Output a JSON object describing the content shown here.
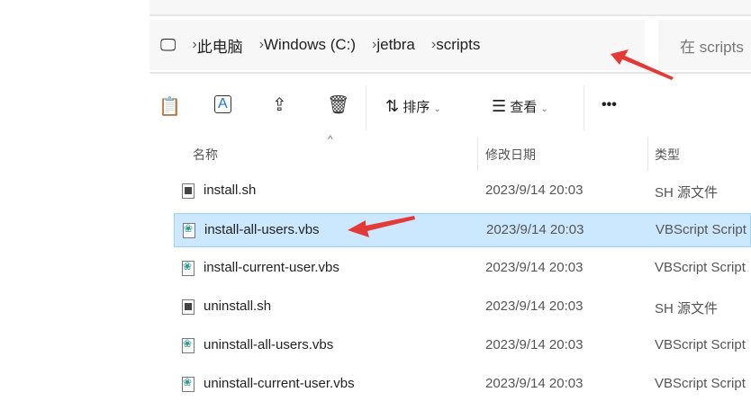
{
  "breadcrumb": [
    "此电脑",
    "Windows (C:)",
    "jetbra",
    "scripts"
  ],
  "search_placeholder": "在 scripts",
  "toolbar": {
    "sort": "排序",
    "view": "查看",
    "more": "•••"
  },
  "columns": {
    "name": "名称",
    "date": "修改日期",
    "type": "类型"
  },
  "files": [
    {
      "name": "install.sh",
      "date": "2023/9/14 20:03",
      "type": "SH 源文件",
      "icon": "sh-file-icon"
    },
    {
      "name": "install-all-users.vbs",
      "date": "2023/9/14 20:03",
      "type": "VBScript Script",
      "icon": "vbs-file-icon",
      "selected": true
    },
    {
      "name": "install-current-user.vbs",
      "date": "2023/9/14 20:03",
      "type": "VBScript Script",
      "icon": "vbs-file-icon"
    },
    {
      "name": "uninstall.sh",
      "date": "2023/9/14 20:03",
      "type": "SH 源文件",
      "icon": "sh-file-icon"
    },
    {
      "name": "uninstall-all-users.vbs",
      "date": "2023/9/14 20:03",
      "type": "VBScript Script",
      "icon": "vbs-file-icon"
    },
    {
      "name": "uninstall-current-user.vbs",
      "date": "2023/9/14 20:03",
      "type": "VBScript Script",
      "icon": "vbs-file-icon"
    }
  ],
  "colors": {
    "selection": "#cce8ff",
    "annotation_arrow": "#e53935"
  }
}
